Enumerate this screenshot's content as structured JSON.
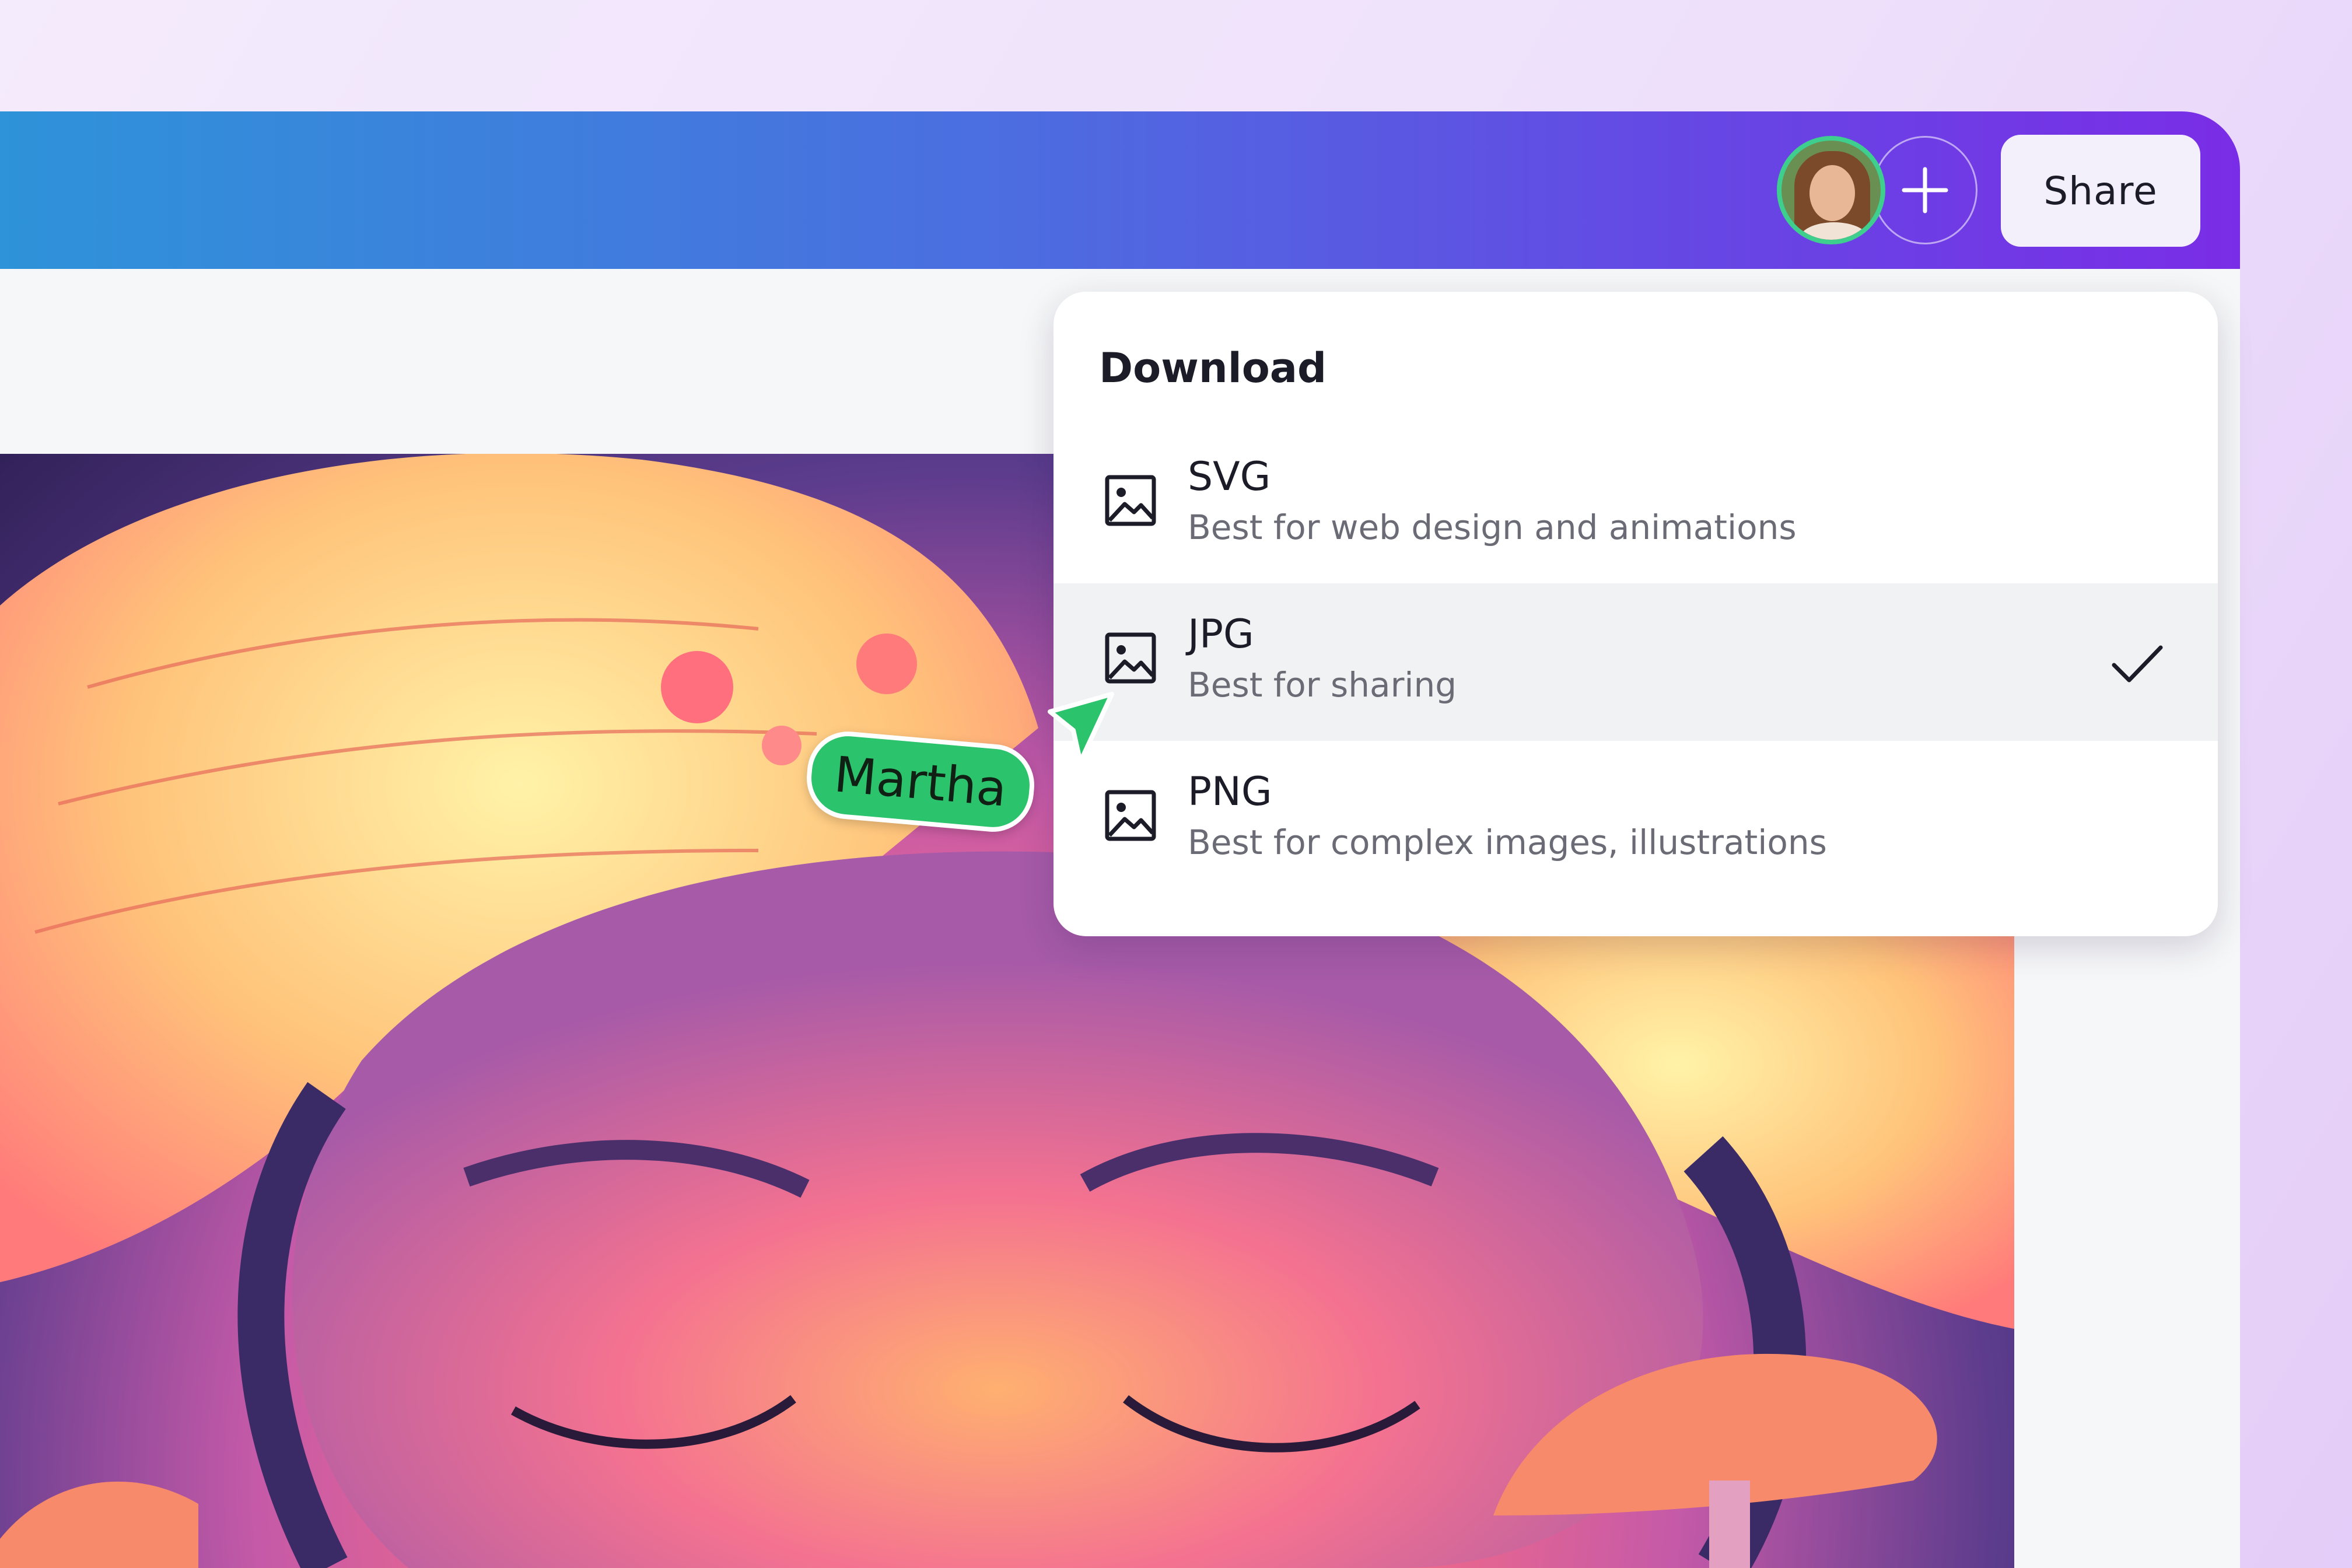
{
  "header": {
    "avatar_icon": "user-avatar",
    "add_icon": "plus-icon",
    "share_label": "Share"
  },
  "download_menu": {
    "title": "Download",
    "options": [
      {
        "name": "SVG",
        "description": "Best for web design and animations",
        "icon": "image-icon",
        "selected": false
      },
      {
        "name": "JPG",
        "description": "Best for sharing",
        "icon": "image-icon",
        "selected": true
      },
      {
        "name": "PNG",
        "description": "Best for complex images, illustrations",
        "icon": "image-icon",
        "selected": false
      }
    ],
    "selected_icon": "check-icon"
  },
  "collaborator_cursor": {
    "label": "Martha",
    "color": "#2bc36b"
  },
  "colors": {
    "topbar_start": "#2e93d9",
    "topbar_end": "#7a2de6",
    "accent_green": "#3ecf8e"
  }
}
